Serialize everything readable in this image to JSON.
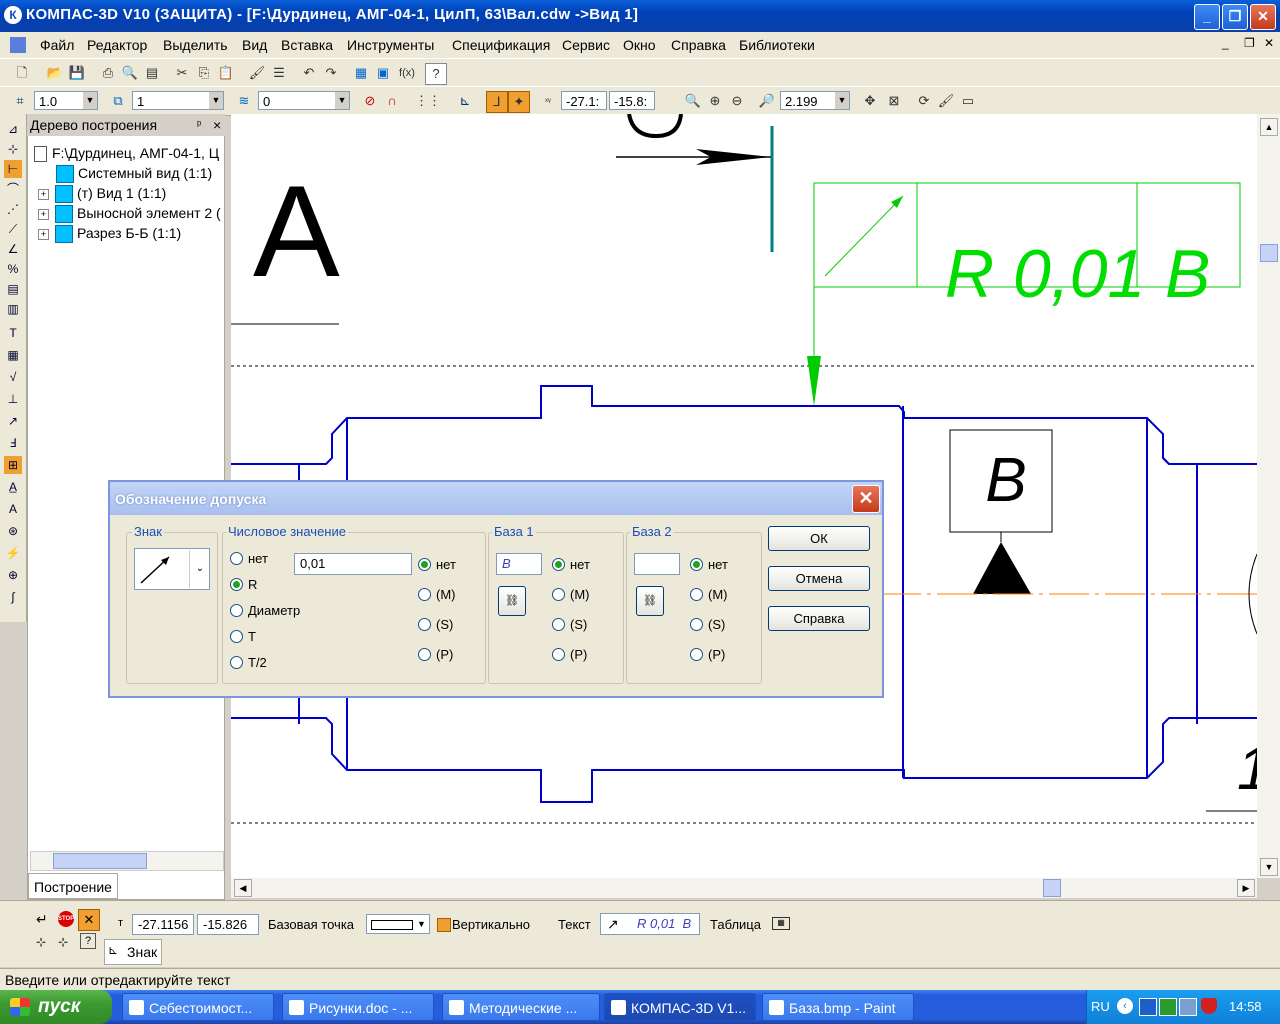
{
  "window": {
    "title": "КОМПАС-3D V10 (ЗАЩИТА) - [F:\\Дурдинец, АМГ-04-1, ЦилП, 63\\Вал.cdw ->Вид 1]",
    "app_icon": "К"
  },
  "menu": [
    "Файл",
    "Редактор",
    "Выделить",
    "Вид",
    "Вставка",
    "Инструменты",
    "Спецификация",
    "Сервис",
    "Окно",
    "Справка",
    "Библиотеки"
  ],
  "toolbar2": {
    "step": "1.0",
    "layer_scale": "1",
    "layer": "0",
    "x": "-27.1:",
    "y": "-15.8:",
    "zoom": "2.199",
    "fx": "f(x)"
  },
  "tree": {
    "header": "Дерево построения",
    "pin": "ᵖ",
    "close": "×",
    "root": "F:\\Дурдинец, АМГ-04-1, Ц",
    "items": [
      "Системный вид (1:1)",
      "(т) Вид 1 (1:1)",
      "Выносной элемент 2 (",
      "Разрез Б-Б (1:1)"
    ],
    "tab": "Построение"
  },
  "drawing": {
    "view_letter": "А",
    "base_letter": "В",
    "tol_value": "R 0,01",
    "tol_base": "B",
    "corner_label": "1,"
  },
  "dialog": {
    "title": "Обозначение допуска",
    "group_sign": "Знак",
    "group_value": "Числовое значение",
    "value_options": [
      "нет",
      "R",
      "Диаметр",
      "T",
      "T/2"
    ],
    "value_selected": 1,
    "value_text": "0,01",
    "modifier_options": [
      "нет",
      "(M)",
      "(S)",
      "(P)"
    ],
    "group_base1": "База 1",
    "base1_value": "B",
    "group_base2": "База 2",
    "base2_value": "",
    "ok": "ОК",
    "cancel": "Отмена",
    "help": "Справка"
  },
  "props": {
    "t_label": "т",
    "x": "-27.1156",
    "y": "-15.826",
    "base_point": "Базовая точка",
    "vertical": "Вертикально",
    "text": "Текст",
    "text_preview": "R 0,01  B",
    "table": "Таблица",
    "tab": "Знак",
    "stop": "STOP"
  },
  "status": "Введите или отредактируйте текст",
  "taskbar": {
    "start": "пуск",
    "tasks": [
      "Себестоимост...",
      "Рисунки.doc - ...",
      "Методические ...",
      "КОМПАС-3D V1...",
      "База.bmp - Paint"
    ],
    "lang": "RU",
    "clock": "14:58"
  },
  "colors": {
    "drawing_blue": "#0000cc",
    "tolerance_green": "#00dd00",
    "axis_orange": "#ff8000",
    "teal": "#008080"
  }
}
